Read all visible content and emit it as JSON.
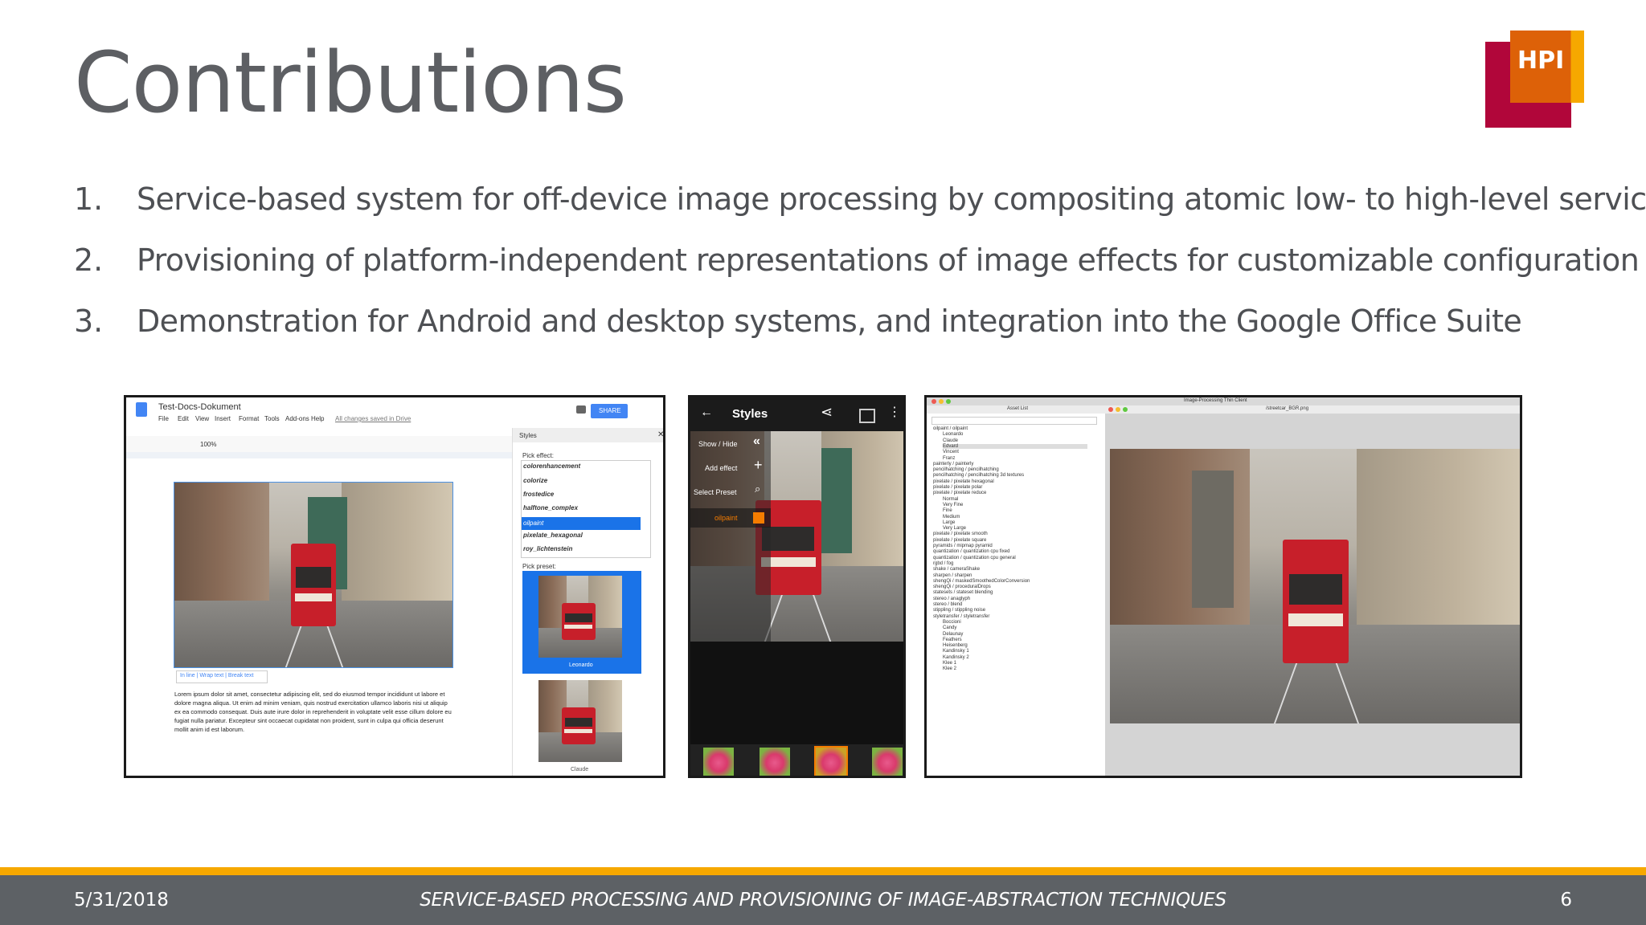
{
  "title": "Contributions",
  "logo": {
    "text": "HPI",
    "colors": {
      "red": "#b1063a",
      "orange": "#dd6108",
      "yellow": "#f6a800"
    }
  },
  "contributions": [
    {
      "num": "1.",
      "text": "Service-based system for off-device image processing by compositing atomic low- to high-level services"
    },
    {
      "num": "2.",
      "text": "Provisioning of platform-independent representations of image effects for customizable configuration"
    },
    {
      "num": "3.",
      "text": "Demonstration for Android and desktop systems, and integration into the Google Office Suite"
    }
  ],
  "docs": {
    "doc_title": "Test-Docs-Dokument",
    "menu": [
      "File",
      "Edit",
      "View",
      "Insert",
      "Format",
      "Tools",
      "Add-ons",
      "Help"
    ],
    "saved": "All changes saved in Drive",
    "share": "SHARE",
    "zoom": "100%",
    "panel_title": "Styles",
    "pick_effect": "Pick effect:",
    "effects": [
      "colorenhancement",
      "colorize",
      "frostedice",
      "halftone_complex",
      "oilpaint",
      "pixelate_hexagonal",
      "roy_lichtenstein"
    ],
    "selected_effect": "oilpaint",
    "pick_preset": "Pick preset:",
    "presets": [
      "Leonardo",
      "Claude"
    ],
    "wrap": "In line | Wrap text | Break text",
    "lorem": "Lorem ipsum dolor sit amet, consectetur adipiscing elit, sed do eiusmod tempor incididunt ut labore et dolore magna aliqua. Ut enim ad minim veniam, quis nostrud exercitation ullamco laboris nisi ut aliquip ex ea commodo consequat. Duis aute irure dolor in reprehenderit in voluptate velit esse cillum dolore eu fugiat nulla pariatur. Excepteur sint occaecat cupidatat non proident, sunt in culpa qui officia deserunt mollit anim id est laborum."
  },
  "android": {
    "title": "Styles",
    "show_hide": "Show / Hide",
    "add_effect": "Add effect",
    "select_preset": "Select Preset",
    "current": "oilpaint"
  },
  "desktop": {
    "window_title": "Image-Processing Thin Client",
    "asset_list": "Asset List",
    "file": "/streetcar_BGR.png",
    "tree": [
      "oilpaint / oilpaint",
      "Leonardo",
      "Claude",
      "Edvard",
      "Vincent",
      "Franz",
      "painterly / painterly",
      "pencilhatching / pencilhatching",
      "pencilhatching / pencilhatching 3d textures",
      "pixelate / pixelate hexagonal",
      "pixelate / pixelate polar",
      "pixelate / pixelate reduce",
      "Normal",
      "Very Fine",
      "Fine",
      "Medium",
      "Large",
      "Very Large",
      "pixelate / pixelate smooth",
      "pixelate / pixelate square",
      "pyramids / mipmap pyramid",
      "quantization / quantization cpu fixed",
      "quantization / quantization cpu general",
      "rgbd / fog",
      "shake / cameraShake",
      "sharpen / sharpen",
      "shengQi / maskedSmoothedColorConversion",
      "shengQi / proceduralDrops",
      "statesets / stateset blending",
      "stereo / anaglyph",
      "stereo / blend",
      "stippling / stippling noise",
      "styletransfer / styletransfer",
      "Boccioni",
      "Candy",
      "Delaunay",
      "Feathers",
      "Heisenberg",
      "Kandinsky 1",
      "Kandinsky 2",
      "Klee 1",
      "Klee 2"
    ]
  },
  "footer": {
    "date": "5/31/2018",
    "center": "SERVICE-BASED PROCESSING AND PROVISIONING OF IMAGE-ABSTRACTION TECHNIQUES",
    "page": "6"
  }
}
